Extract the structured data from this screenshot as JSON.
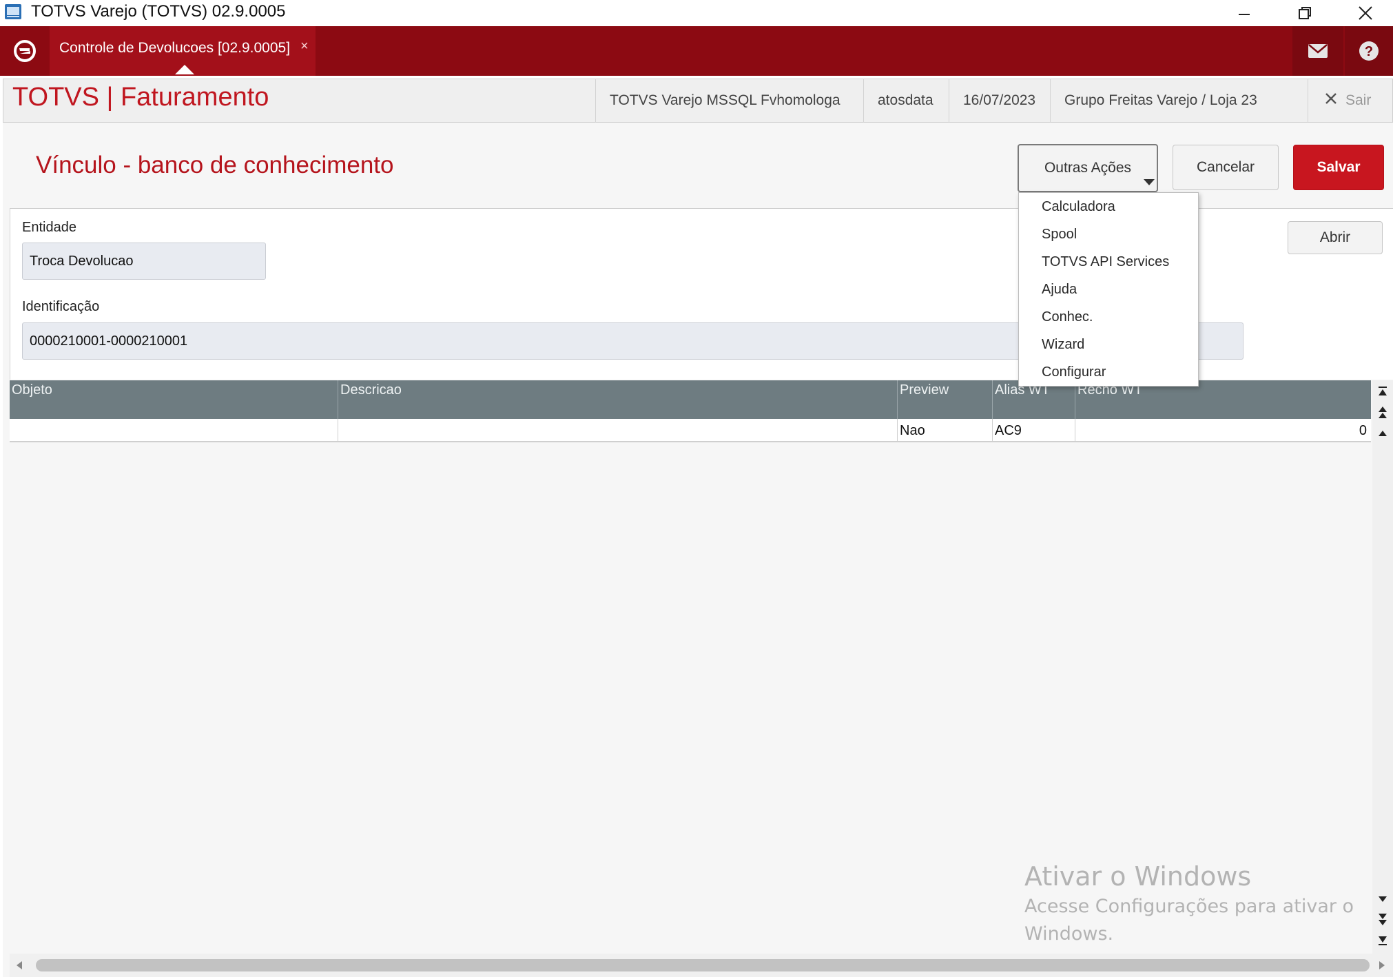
{
  "window": {
    "title": "TOTVS Varejo (TOTVS) 02.9.0005"
  },
  "appbar": {
    "tab_label": "Controle de Devolucoes [02.9.0005]",
    "tab_close": "×"
  },
  "header": {
    "brand": "TOTVS | Faturamento",
    "environment": "TOTVS Varejo MSSQL Fvhomologa",
    "user": "atosdata",
    "date": "16/07/2023",
    "branch": "Grupo Freitas Varejo / Loja 23",
    "exit_label": "Sair"
  },
  "form": {
    "title": "Vínculo - banco de conhecimento",
    "other_actions_label": "Outras Ações",
    "cancel_label": "Cancelar",
    "save_label": "Salvar",
    "open_label": "Abrir",
    "entity_label": "Entidade",
    "entity_value": "Troca Devolucao",
    "id_label": "Identificação",
    "id_value": "0000210001-0000210001"
  },
  "menu": {
    "items": [
      "Calculadora",
      "Spool",
      "TOTVS API Services",
      "Ajuda",
      "Conhec.",
      "Wizard",
      "Configurar"
    ]
  },
  "grid": {
    "columns": [
      "Objeto",
      "Descricao",
      "Preview",
      "Alias WT",
      "Recno WT"
    ],
    "row": {
      "objeto": "",
      "descricao": "",
      "preview": "Nao",
      "alias": "AC9",
      "recno": "0"
    }
  },
  "watermark": {
    "line1": "Ativar o Windows",
    "line2": "Acesse Configurações para ativar o",
    "line3": "Windows."
  },
  "colors": {
    "brand_red": "#8c0a12",
    "accent_red": "#c8161f",
    "grid_header": "#6e7c81"
  }
}
